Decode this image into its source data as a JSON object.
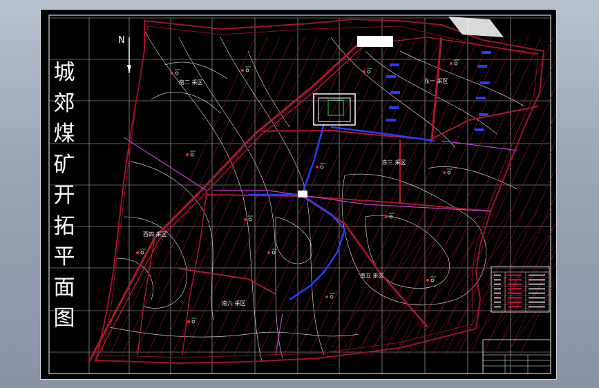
{
  "drawing": {
    "title": "城郊煤矿开拓平面图",
    "north_label": "N",
    "zones": [
      {
        "id": "nan-er",
        "label": "南二  采区"
      },
      {
        "id": "dong-yi",
        "label": "东一  采区"
      },
      {
        "id": "dong-san",
        "label": "东三  采区"
      },
      {
        "id": "xi-si",
        "label": "西四  采区"
      },
      {
        "id": "nan-wu",
        "label": "南五  采区"
      },
      {
        "id": "nan-liu",
        "label": "南六  采区"
      }
    ]
  },
  "colors": {
    "background": "#000000",
    "grid": "#ffffff",
    "contours": "#ffffff",
    "roadways": "#b0182a",
    "seam_lines": "#a01426",
    "main_shafts": "#2a3cff",
    "boundary": "#a01426",
    "purple_lines": "#c040d0",
    "green_symbols": "#33dd55",
    "window_bg_top": "#b8c2cf",
    "window_bg_bottom": "#8794a6"
  }
}
